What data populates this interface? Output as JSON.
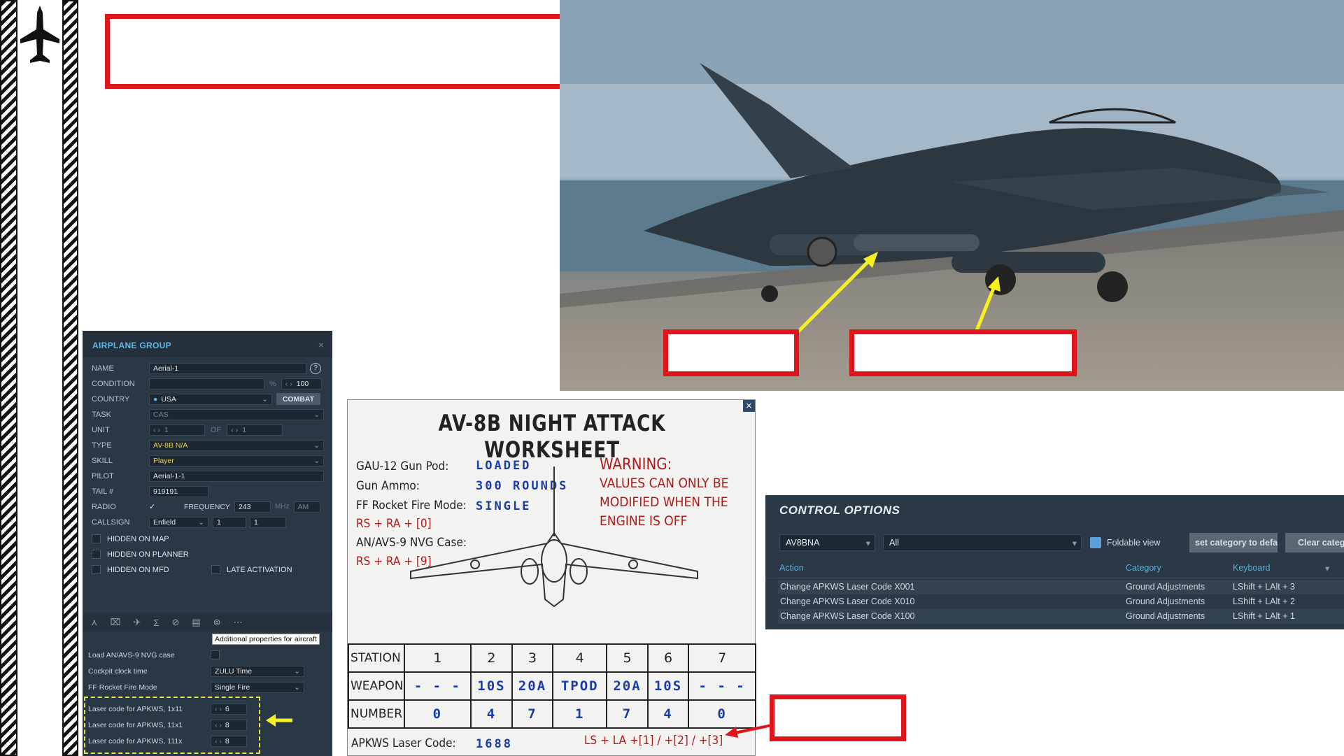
{
  "airplane_group": {
    "title": "AIRPLANE GROUP",
    "close": "×",
    "name_label": "NAME",
    "name": "Aerial-1",
    "help": "?",
    "condition_label": "CONDITION",
    "condition_unit": "%",
    "condition_value": "100",
    "country_label": "COUNTRY",
    "country": "USA",
    "combat": "COMBAT",
    "task_label": "TASK",
    "task": "CAS",
    "unit_label": "UNIT",
    "unit": "1",
    "of": "OF",
    "unit_of": "1",
    "type_label": "TYPE",
    "type": "AV-8B N/A",
    "skill_label": "SKILL",
    "skill": "Player",
    "pilot_label": "PILOT",
    "pilot": "Aerial-1-1",
    "tail_label": "TAIL #",
    "tail": "919191",
    "radio_label": "RADIO",
    "radio_check": "✓",
    "freq_label": "FREQUENCY",
    "freq": "243",
    "mhz": "MHz",
    "am": "AM",
    "callsign_label": "CALLSIGN",
    "callsign": "Enfield",
    "cs1": "1",
    "cs2": "1",
    "hidden_map": "HIDDEN ON MAP",
    "hidden_planner": "HIDDEN ON PLANNER",
    "hidden_mfd": "HIDDEN ON MFD",
    "late": "LATE ACTIVATION",
    "tooltip": "Additional properties for aircraft",
    "nvg_label": "Load AN/AVS-9 NVG case",
    "clock_label": "Cockpit clock time",
    "clock": "ZULU Time",
    "rocket_label": "FF Rocket Fire Mode",
    "rocket": "Single Fire",
    "laser1_label": "Laser code for APKWS, 1x11",
    "laser1": "6",
    "laser2_label": "Laser code for APKWS, 11x1",
    "laser2": "8",
    "laser3_label": "Laser code for APKWS, 111x",
    "laser3": "8"
  },
  "worksheet": {
    "title": "AV-8B NIGHT ATTACK WORKSHEET",
    "close": "✕",
    "gun_pod": "GAU-12 Gun Pod:",
    "gun_pod_v": "LOADED",
    "ammo": "Gun Ammo:",
    "ammo_v": "300 ROUNDS",
    "ff": "FF Rocket Fire Mode:",
    "ff_v": "SINGLE",
    "ff_keys": "RS + RA + [0]",
    "nvg": "AN/AVS-9 NVG Case:",
    "nvg_keys": "RS + RA + [9]",
    "warn1": "WARNING:",
    "warn2": "VALUES CAN ONLY BE",
    "warn3": "MODIFIED WHEN THE",
    "warn4": "ENGINE IS OFF",
    "station_label": "STATION",
    "stations": [
      "1",
      "2",
      "3",
      "4",
      "5",
      "6",
      "7"
    ],
    "weapon_label": "WEAPON",
    "weapons": [
      "- - -",
      "10S",
      "20A",
      "TPOD",
      "20A",
      "10S",
      "- - -"
    ],
    "number_label": "NUMBER",
    "numbers": [
      "0",
      "4",
      "7",
      "1",
      "7",
      "4",
      "0"
    ],
    "apkws_label": "APKWS Laser Code:",
    "apkws_code": "1688",
    "apkws_keys": "LS + LA +[1] / +[2] / +[3]"
  },
  "control_options": {
    "title": "CONTROL OPTIONS",
    "aircraft": "AV8BNA",
    "filter": "All",
    "foldable": "Foldable view",
    "reset_btn": "set category to defa",
    "clear_btn": "Clear categ",
    "col_action": "Action",
    "col_category": "Category",
    "col_keyboard": "Keyboard",
    "rows": [
      {
        "action": "Change APKWS Laser Code X001",
        "category": "Ground Adjustments",
        "key": "LShift + LAlt + 3"
      },
      {
        "action": "Change APKWS Laser Code X010",
        "category": "Ground Adjustments",
        "key": "LShift + LAlt + 2"
      },
      {
        "action": "Change APKWS Laser Code X100",
        "category": "Ground Adjustments",
        "key": "LShift + LAlt + 1"
      }
    ]
  },
  "colors": {
    "callout": "#e0141b",
    "arrow": "#f5f01e",
    "panel": "#2a3744",
    "accent": "#5fb8e8"
  }
}
